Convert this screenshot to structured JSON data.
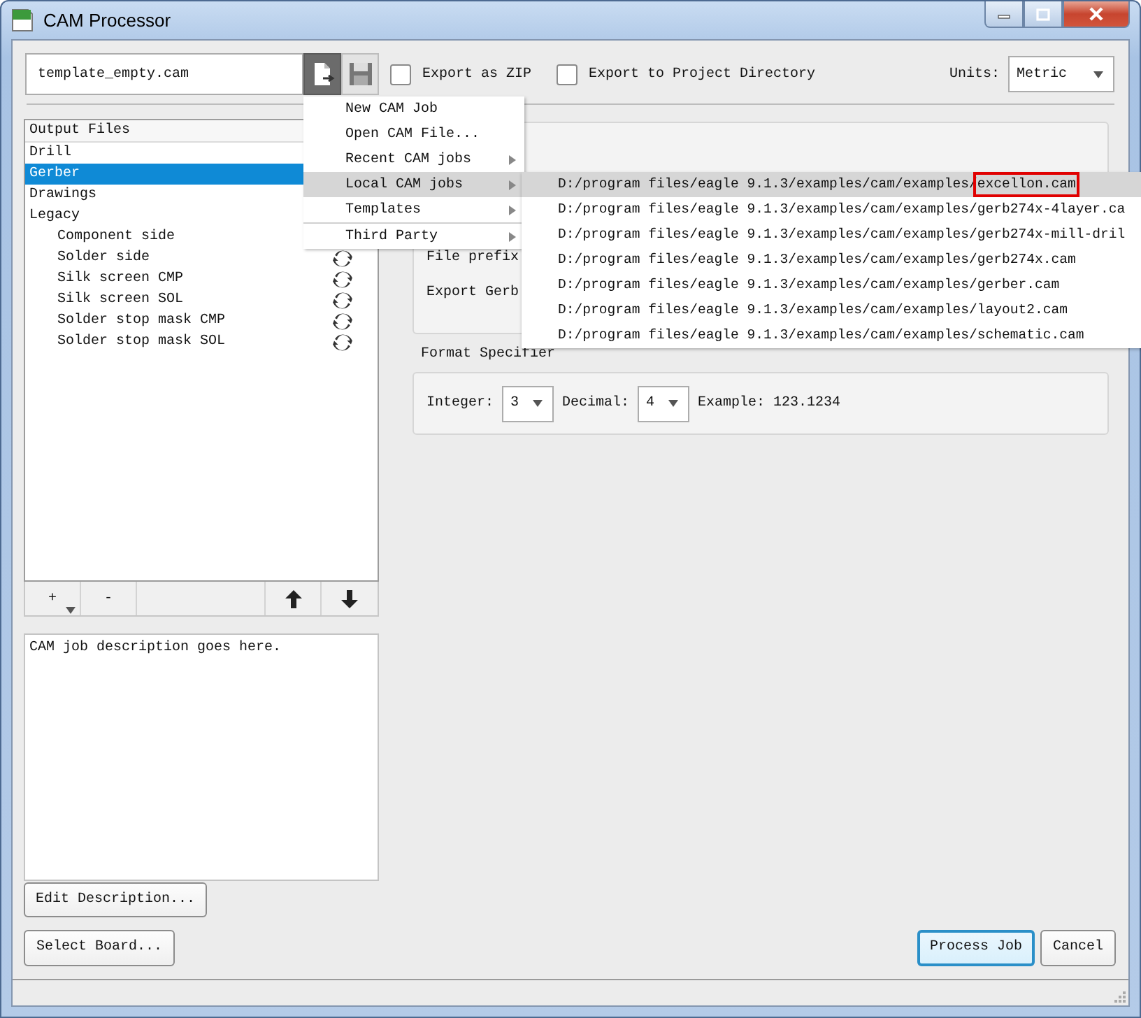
{
  "window": {
    "title": "CAM Processor"
  },
  "job_file": {
    "value": "template_empty.cam"
  },
  "file_buttons": [
    {
      "kind": "new",
      "pressed": true
    },
    {
      "kind": "save",
      "pressed": false
    }
  ],
  "options": [
    {
      "label": "Export as ZIP",
      "checked": false
    },
    {
      "label": "Export to Project Directory",
      "checked": false
    }
  ],
  "units": {
    "label": "Units:",
    "value": "Metric"
  },
  "output_files": {
    "header": "Output Files",
    "items": [
      {
        "label": "Drill",
        "selected": false
      },
      {
        "label": "Gerber",
        "selected": true
      },
      {
        "label": "Drawings",
        "selected": false
      },
      {
        "label": "Legacy",
        "selected": false,
        "children": [
          {
            "label": "Component side",
            "selected": false
          },
          {
            "label": "Solder side",
            "selected": false,
            "sync": true
          },
          {
            "label": "Silk screen CMP",
            "selected": false,
            "sync": true
          },
          {
            "label": "Silk screen SOL",
            "selected": false,
            "sync": true
          },
          {
            "label": "Solder stop mask CMP",
            "selected": false,
            "sync": true
          },
          {
            "label": "Solder stop mask SOL",
            "selected": false,
            "sync": true
          }
        ]
      }
    ]
  },
  "list_toolbar": {
    "add": "+",
    "remove": "-"
  },
  "description": {
    "value": "CAM job description goes here."
  },
  "edit_description_button": "Edit Description...",
  "output_settings": {
    "labels": [
      "File prefix",
      "Export Gerb"
    ]
  },
  "format_specifier": {
    "title": "Format Specifier",
    "integer": {
      "label": "Integer:",
      "value": "3"
    },
    "decimal": {
      "label": "Decimal:",
      "value": "4"
    },
    "example": "Example: 123.1234"
  },
  "select_board_button": "Select Board...",
  "actions": [
    {
      "label": "Process Job",
      "default": true
    },
    {
      "label": "Cancel",
      "default": false
    }
  ],
  "menu": {
    "items": [
      {
        "label": "New CAM Job",
        "submenu": false,
        "selected": false,
        "separator_before": false
      },
      {
        "label": "Open CAM File...",
        "submenu": false,
        "selected": false,
        "separator_before": false
      },
      {
        "label": "Recent CAM jobs",
        "submenu": true,
        "selected": false,
        "separator_before": false
      },
      {
        "label": "Local CAM jobs",
        "submenu": true,
        "selected": true,
        "separator_before": false
      },
      {
        "label": "Templates",
        "submenu": true,
        "selected": false,
        "separator_before": false
      },
      {
        "label": "Third Party",
        "submenu": true,
        "selected": false,
        "separator_before": true
      }
    ]
  },
  "submenu": {
    "items": [
      {
        "label": "D:/program files/eagle 9.1.3/examples/cam/examples/excellon.cam",
        "selected": true,
        "annotated": true
      },
      {
        "label": "D:/program files/eagle 9.1.3/examples/cam/examples/gerb274x-4layer.ca",
        "selected": false,
        "annotated": false
      },
      {
        "label": "D:/program files/eagle 9.1.3/examples/cam/examples/gerb274x-mill-dril",
        "selected": false,
        "annotated": false
      },
      {
        "label": "D:/program files/eagle 9.1.3/examples/cam/examples/gerb274x.cam",
        "selected": false,
        "annotated": false
      },
      {
        "label": "D:/program files/eagle 9.1.3/examples/cam/examples/gerber.cam",
        "selected": false,
        "annotated": false
      },
      {
        "label": "D:/program files/eagle 9.1.3/examples/cam/examples/layout2.cam",
        "selected": false,
        "annotated": false
      },
      {
        "label": "D:/program files/eagle 9.1.3/examples/cam/examples/schematic.cam",
        "selected": false,
        "annotated": false
      }
    ]
  }
}
